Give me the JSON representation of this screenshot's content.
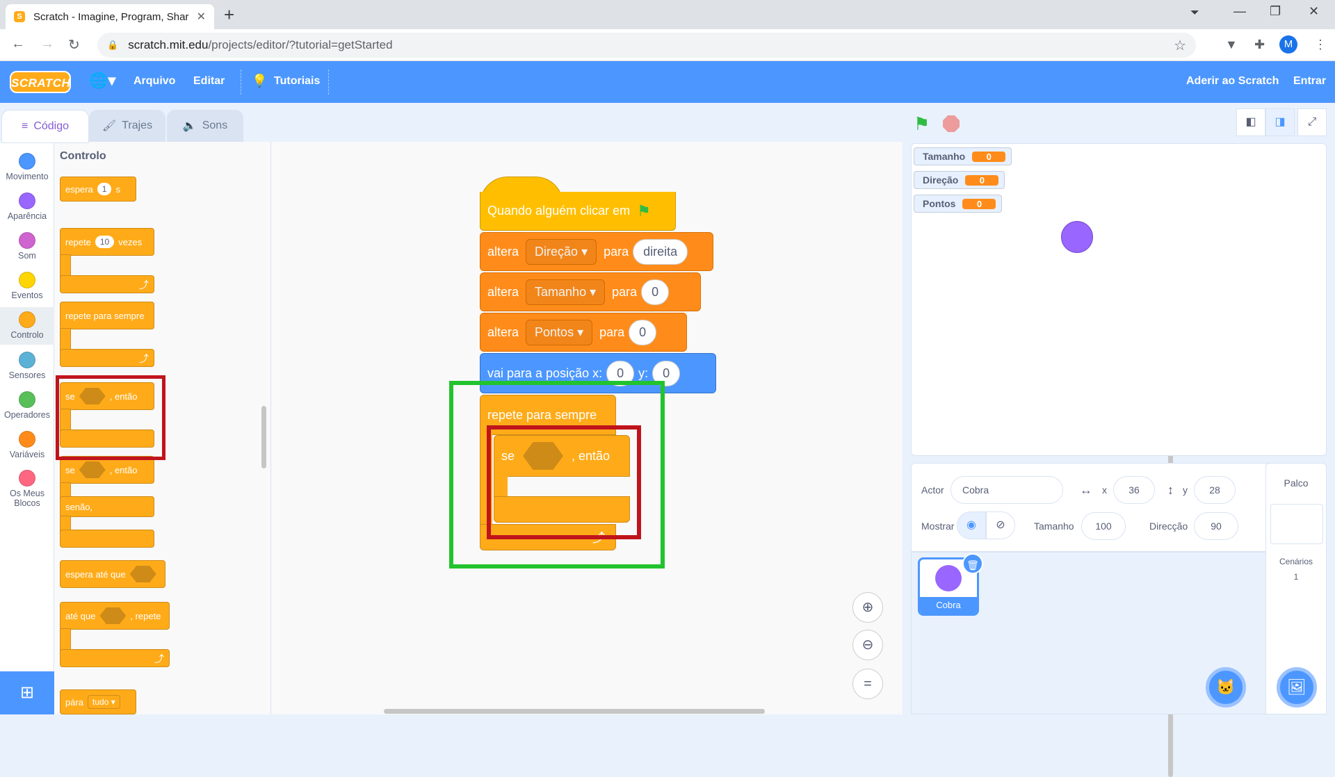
{
  "browser": {
    "tab_title": "Scratch - Imagine, Program, Shar",
    "url_host": "scratch.mit.edu",
    "url_path": "/projects/editor/?tutorial=getStarted",
    "profile_initial": "M"
  },
  "menubar": {
    "logo": "SCRATCH",
    "file": "Arquivo",
    "edit": "Editar",
    "tutorials": "Tutoriais",
    "join": "Aderir ao Scratch",
    "signin": "Entrar"
  },
  "tabs": {
    "code": "Código",
    "costumes": "Trajes",
    "sounds": "Sons"
  },
  "categories": [
    {
      "label": "Movimento",
      "color": "#4c97ff"
    },
    {
      "label": "Aparência",
      "color": "#9966ff"
    },
    {
      "label": "Som",
      "color": "#cf63cf"
    },
    {
      "label": "Eventos",
      "color": "#ffd500"
    },
    {
      "label": "Controlo",
      "color": "#ffab19"
    },
    {
      "label": "Sensores",
      "color": "#5cb1d6"
    },
    {
      "label": "Operadores",
      "color": "#59c059"
    },
    {
      "label": "Variáveis",
      "color": "#ff8c1a"
    },
    {
      "label": "Os Meus Blocos",
      "color": "#ff6680"
    }
  ],
  "palette": {
    "title": "Controlo",
    "wait": {
      "text": "espera",
      "value": "1",
      "unit": "s"
    },
    "repeat": {
      "text": "repete",
      "value": "10",
      "suffix": "vezes"
    },
    "forever": "repete para sempre",
    "if_then": {
      "if": "se",
      "then": ", então"
    },
    "if_else": {
      "if": "se",
      "then": ", então",
      "else": "senão,"
    },
    "wait_until": "espera até que",
    "repeat_until": {
      "text": "até que",
      "suffix": ", repete"
    },
    "stop": {
      "text": "pára",
      "option": "tudo"
    }
  },
  "script": {
    "hat": "Quando alguém clicar em",
    "set1": {
      "verb": "altera",
      "var": "Direção",
      "to": "para",
      "value": "direita"
    },
    "set2": {
      "verb": "altera",
      "var": "Tamanho",
      "to": "para",
      "value": "0"
    },
    "set3": {
      "verb": "altera",
      "var": "Pontos",
      "to": "para",
      "value": "0"
    },
    "goto": {
      "text": "vai para a posição x:",
      "x": "0",
      "ylabel": "y:",
      "y": "0"
    },
    "forever": "repete para sempre",
    "if": {
      "if": "se",
      "then": ", então"
    }
  },
  "monitors": [
    {
      "name": "Tamanho",
      "value": "0"
    },
    {
      "name": "Direção",
      "value": "0"
    },
    {
      "name": "Pontos",
      "value": "0"
    }
  ],
  "sprite_info": {
    "actor_label": "Actor",
    "actor_name": "Cobra",
    "x_label": "x",
    "x": "36",
    "y_label": "y",
    "y": "28",
    "show_label": "Mostrar",
    "size_label": "Tamanho",
    "size": "100",
    "direction_label": "Direcção",
    "direction": "90"
  },
  "sprites": [
    {
      "name": "Cobra"
    }
  ],
  "stage_panel": {
    "title": "Palco",
    "backdrops_label": "Cenários",
    "backdrops_count": "1"
  },
  "colors": {
    "scratch_blue": "#4c97ff",
    "control": "#ffab19",
    "variables": "#ff8c1a",
    "highlight_green": "#22c32e",
    "highlight_red": "#c0141c"
  }
}
